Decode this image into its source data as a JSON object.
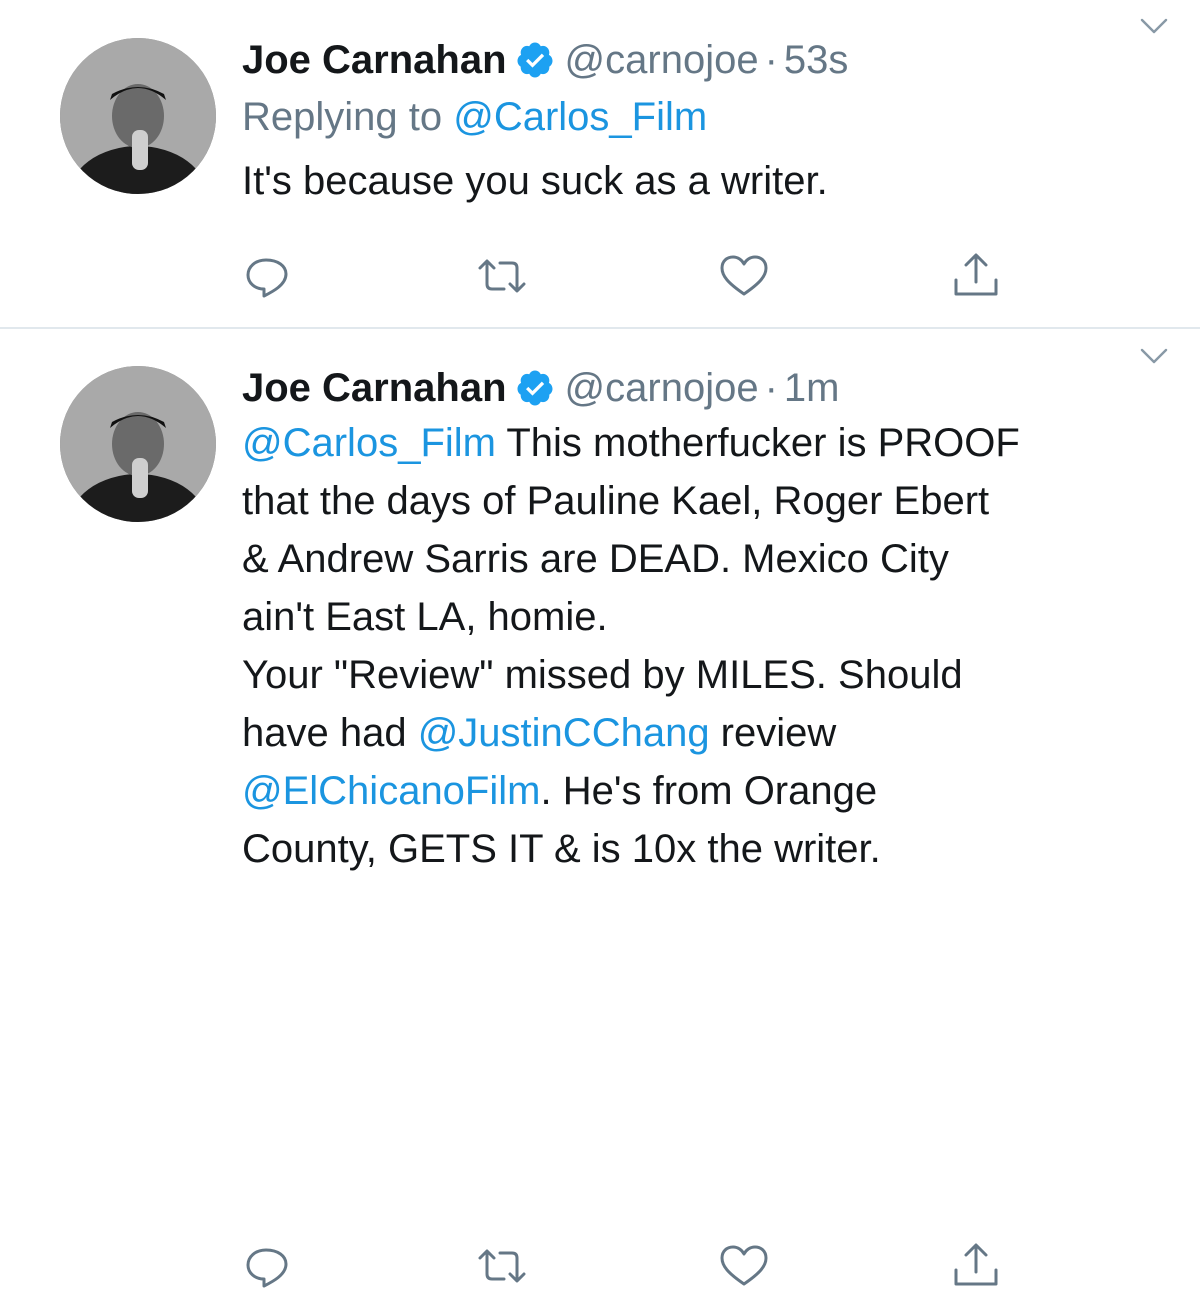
{
  "colors": {
    "link": "#1b95e0",
    "secondary": "#657786",
    "verified": "#1da1f2",
    "divider": "#e1e8ed"
  },
  "tweets": [
    {
      "name": "Joe Carnahan",
      "handle": "@carnojoe",
      "dot": "·",
      "time": "53s",
      "replying_prefix": "Replying to ",
      "replying_to": "@Carlos_Film",
      "body_line1": "It's because you suck as a writer."
    },
    {
      "name": "Joe Carnahan",
      "handle": "@carnojoe",
      "dot": "·",
      "time": "1m",
      "mention_carlos": "@Carlos_Film",
      "line1_rest": " This motherfucker is PROOF",
      "line2": "that the days of Pauline Kael, Roger Ebert",
      "line3": "& Andrew Sarris are DEAD. Mexico City",
      "line4": "ain't East LA, homie.",
      "line5": "Your \"Review\" missed by MILES. Should",
      "line6_pre": "have had ",
      "mention_justin": "@JustinCChang",
      "line6_post": " review",
      "mention_elchicano": "@ElChicanoFilm",
      "line7_post": ". He's from Orange",
      "line8": "County, GETS IT & is 10x the writer."
    }
  ],
  "icons": [
    "avatar-photo",
    "verified-badge-icon",
    "chevron-down-icon",
    "reply-icon",
    "retweet-icon",
    "like-heart-icon",
    "share-icon"
  ]
}
